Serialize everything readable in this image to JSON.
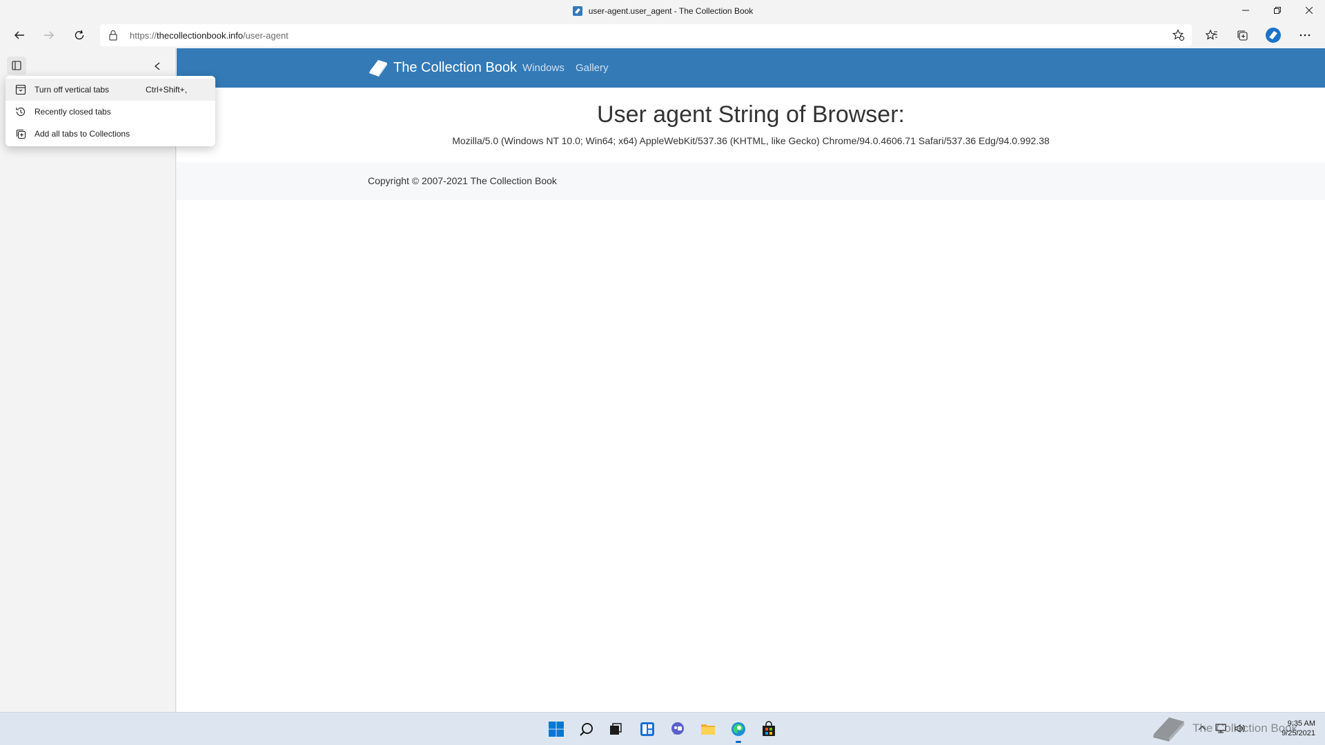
{
  "window": {
    "title": "user-agent.user_agent - The Collection Book"
  },
  "toolbar": {
    "url_prefix": "https://",
    "url_domain": "thecollectionbook.info",
    "url_path": "/user-agent"
  },
  "menu": {
    "items": [
      {
        "label": "Turn off vertical tabs",
        "shortcut": "Ctrl+Shift+,",
        "icon": "vertical-tabs-icon"
      },
      {
        "label": "Recently closed tabs",
        "shortcut": "",
        "icon": "history-icon"
      },
      {
        "label": "Add all tabs to Collections",
        "shortcut": "",
        "icon": "collections-icon"
      }
    ]
  },
  "site": {
    "brand": "The Collection Book",
    "nav": [
      "Windows",
      "Gallery"
    ],
    "heading": "User agent String of Browser:",
    "user_agent": "Mozilla/5.0 (Windows NT 10.0; Win64; x64) AppleWebKit/537.36 (KHTML, like Gecko) Chrome/94.0.4606.71 Safari/537.36 Edg/94.0.992.38",
    "copyright": "Copyright © 2007-2021 The Collection Book"
  },
  "taskbar": {
    "time": "9:35 AM",
    "date": "9/25/2021",
    "watermark": "The Collection Book"
  },
  "colors": {
    "navbar": "#337ab7",
    "accent": "#0067c0"
  }
}
